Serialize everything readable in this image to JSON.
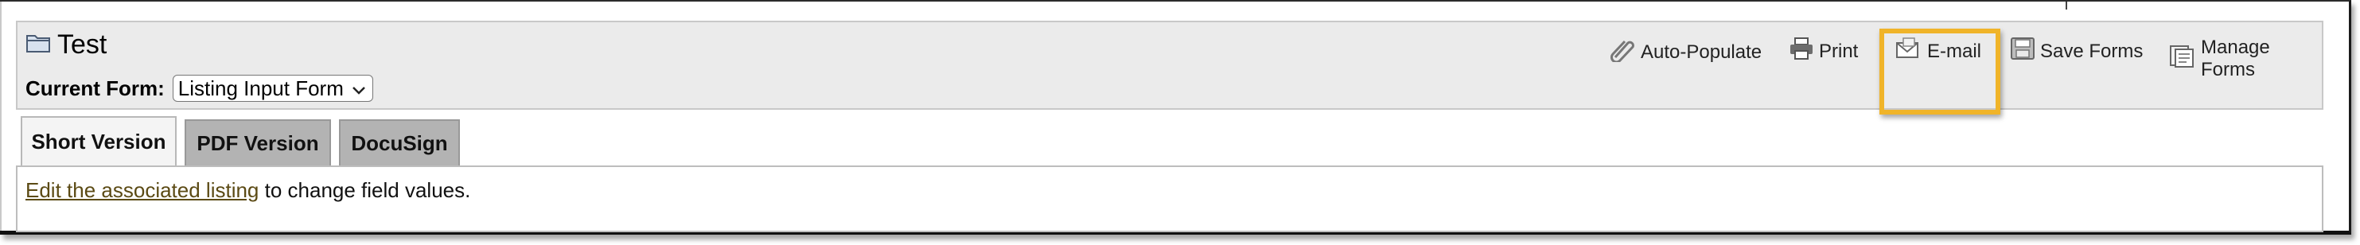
{
  "header": {
    "title": "Test",
    "current_form_label": "Current Form:",
    "current_form_value": "Listing Input Form"
  },
  "toolbar": {
    "auto_populate": "Auto-Populate",
    "print": "Print",
    "email": "E-mail",
    "save_forms": "Save Forms",
    "manage_forms": "Manage Forms"
  },
  "tabs": [
    {
      "label": "Short Version",
      "active": true
    },
    {
      "label": "PDF Version",
      "active": false
    },
    {
      "label": "DocuSign",
      "active": false
    }
  ],
  "content": {
    "link_text": "Edit the associated listing",
    "rest_text": " to change field values."
  },
  "colors": {
    "highlight": "#f0b429",
    "link": "#5b4a14",
    "tab_inactive": "#b3b3b3"
  }
}
